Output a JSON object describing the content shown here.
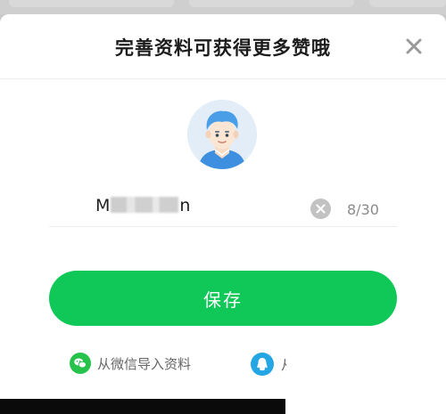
{
  "dialog": {
    "title": "完善资料可获得更多赞哦",
    "close_icon": "close-icon"
  },
  "profile": {
    "avatar_icon": "avatar-icon",
    "nickname_prefix": "M",
    "nickname_suffix": "n",
    "nickname_length": "8/30",
    "clear_icon": "clear-icon"
  },
  "actions": {
    "save_label": "保存"
  },
  "import": {
    "wechat_label": "从微信导入资料",
    "wechat_icon": "wechat-icon",
    "qq_label": "从",
    "qq_icon": "qq-icon"
  },
  "colors": {
    "primary_green": "#0fc857",
    "wechat_green": "#27c24c",
    "qq_blue": "#23a6e3"
  }
}
